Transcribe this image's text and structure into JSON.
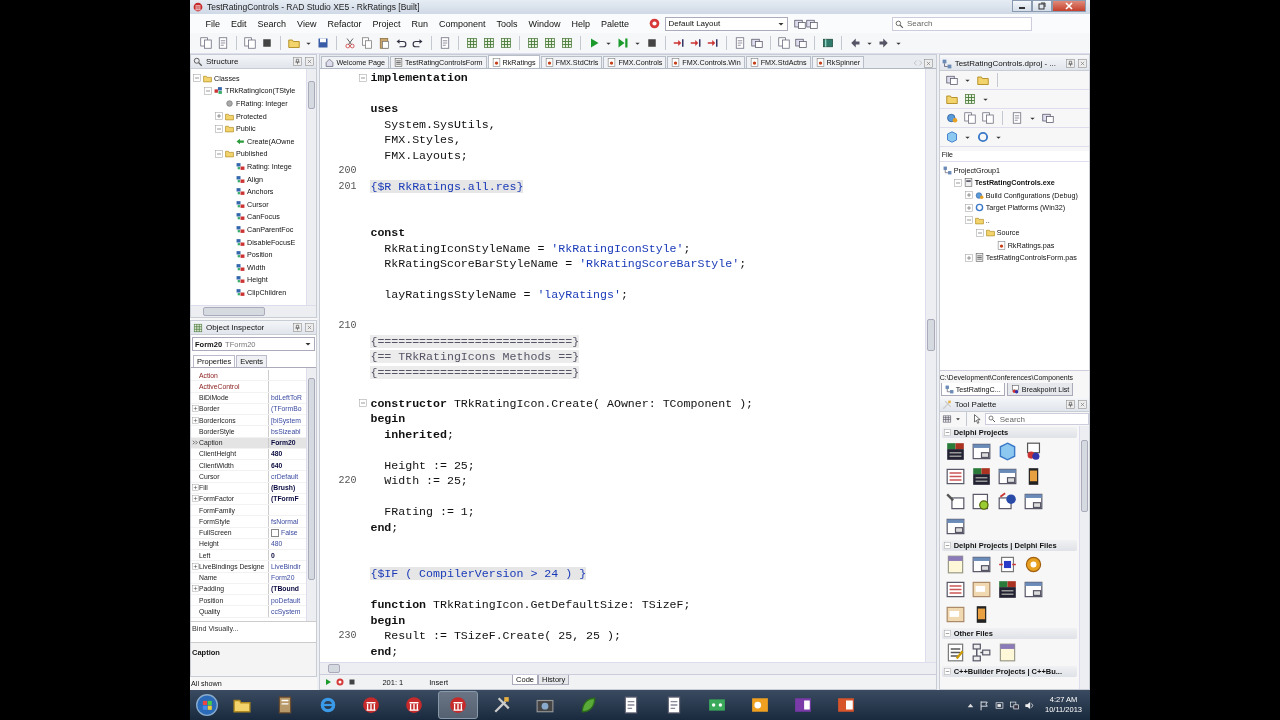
{
  "window": {
    "title": "TestRatingControls - RAD Studio XE5 - RkRatings [Built]"
  },
  "menu": [
    "File",
    "Edit",
    "Search",
    "View",
    "Refactor",
    "Project",
    "Run",
    "Component",
    "Tools",
    "Window",
    "Help",
    "Palette"
  ],
  "layout_dropdown": {
    "value": "Default Layout"
  },
  "ide_search": {
    "placeholder": "Search"
  },
  "structure": {
    "title": "Structure",
    "tree": [
      {
        "label": "Classes",
        "kind": "folder",
        "expanded": true,
        "children": [
          {
            "label": "TRkRatingIcon(TStyle",
            "kind": "class",
            "expanded": true,
            "children": [
              {
                "label": "FRating: Integer",
                "kind": "field"
              },
              {
                "label": "Protected",
                "kind": "folder",
                "expanded": false
              },
              {
                "label": "Public",
                "kind": "folder",
                "expanded": true,
                "children": [
                  {
                    "label": "Create(AOwne",
                    "kind": "method"
                  }
                ]
              },
              {
                "label": "Published",
                "kind": "folder",
                "expanded": true,
                "children": [
                  {
                    "label": "Rating: Intege",
                    "kind": "property"
                  },
                  {
                    "label": "Align",
                    "kind": "property"
                  },
                  {
                    "label": "Anchors",
                    "kind": "property"
                  },
                  {
                    "label": "Cursor",
                    "kind": "property"
                  },
                  {
                    "label": "CanFocus",
                    "kind": "property"
                  },
                  {
                    "label": "CanParentFoc",
                    "kind": "property"
                  },
                  {
                    "label": "DisableFocusE",
                    "kind": "property"
                  },
                  {
                    "label": "Position",
                    "kind": "property"
                  },
                  {
                    "label": "Width",
                    "kind": "property"
                  },
                  {
                    "label": "Height",
                    "kind": "property"
                  },
                  {
                    "label": "ClipChildren",
                    "kind": "property"
                  }
                ]
              }
            ]
          }
        ]
      }
    ]
  },
  "object_inspector": {
    "title": "Object Inspector",
    "component": "Form20",
    "component_type": "TForm20",
    "tabs": [
      {
        "label": "Properties",
        "selected": true
      },
      {
        "label": "Events",
        "selected": false
      }
    ],
    "properties": [
      {
        "name": "Action",
        "kind": "reference",
        "expandable": false,
        "selected": false
      },
      {
        "name": "ActiveControl",
        "kind": "reference",
        "expandable": false,
        "selected": false
      },
      {
        "name": "BiDiMode",
        "value": "bdLeftToR",
        "kind": "property",
        "expandable": false,
        "emphasis": false,
        "selected": false
      },
      {
        "name": "Border",
        "value": "(TFormBo",
        "kind": "property",
        "expandable": true,
        "emphasis": false,
        "selected": false
      },
      {
        "name": "BorderIcons",
        "value": "[biSystem",
        "kind": "property",
        "expandable": true,
        "emphasis": false,
        "selected": false
      },
      {
        "name": "BorderStyle",
        "value": "bsSizeabl",
        "kind": "property",
        "expandable": false,
        "emphasis": false,
        "selected": false
      },
      {
        "name": "Caption",
        "value": "Form20",
        "kind": "property",
        "expandable": false,
        "emphasis": true,
        "selected": true
      },
      {
        "name": "ClientHeight",
        "value": "480",
        "kind": "property",
        "expandable": false,
        "emphasis": true,
        "selected": false
      },
      {
        "name": "ClientWidth",
        "value": "640",
        "kind": "property",
        "expandable": false,
        "emphasis": true,
        "selected": false
      },
      {
        "name": "Cursor",
        "value": "crDefault",
        "kind": "property",
        "expandable": false,
        "emphasis": false,
        "selected": false
      },
      {
        "name": "Fill",
        "value": "(Brush)",
        "kind": "property",
        "expandable": true,
        "emphasis": true,
        "selected": false
      },
      {
        "name": "FormFactor",
        "value": "(TFormF",
        "kind": "property",
        "expandable": true,
        "emphasis": true,
        "selected": false
      },
      {
        "name": "FormFamily",
        "kind": "property",
        "expandable": false,
        "selected": false
      },
      {
        "name": "FormStyle",
        "value": "fsNormal",
        "kind": "property",
        "expandable": false,
        "emphasis": false,
        "selected": false
      },
      {
        "name": "FullScreen",
        "value": "False",
        "kind": "checkbox",
        "checked": false,
        "expandable": false,
        "emphasis": false,
        "selected": false
      },
      {
        "name": "Height",
        "value": "480",
        "kind": "property",
        "expandable": false,
        "emphasis": false,
        "selected": false
      },
      {
        "name": "Left",
        "value": "0",
        "kind": "property",
        "expandable": false,
        "emphasis": true,
        "selected": false
      },
      {
        "name": "LiveBindings Designe",
        "value": "LiveBindir",
        "kind": "property",
        "expandable": true,
        "emphasis": false,
        "selected": false
      },
      {
        "name": "Name",
        "value": "Form20",
        "kind": "property",
        "expandable": false,
        "emphasis": false,
        "selected": false
      },
      {
        "name": "Padding",
        "value": "(TBound",
        "kind": "property",
        "expandable": true,
        "emphasis": true,
        "selected": false
      },
      {
        "name": "Position",
        "value": "poDefault",
        "kind": "property",
        "expandable": false,
        "emphasis": false,
        "selected": false
      },
      {
        "name": "Quality",
        "value": "ccSystem",
        "kind": "property",
        "expandable": false,
        "emphasis": false,
        "selected": false
      }
    ],
    "action_link": "Bind Visually...",
    "description": "Caption",
    "footer": "All shown"
  },
  "editor": {
    "tabs": [
      {
        "label": "Welcome Page",
        "kind": "home",
        "selected": false
      },
      {
        "label": "TestRatingControlsForm",
        "kind": "formfile",
        "selected": false
      },
      {
        "label": "RkRatings",
        "kind": "pas",
        "selected": true
      },
      {
        "label": "FMX.StdCtrls",
        "kind": "pas",
        "selected": false
      },
      {
        "label": "FMX.Controls",
        "kind": "pas",
        "selected": false
      },
      {
        "label": "FMX.Controls.Win",
        "kind": "pas",
        "selected": false
      },
      {
        "label": "FMX.StdActns",
        "kind": "pas",
        "selected": false
      },
      {
        "label": "RkSpinner",
        "kind": "pas",
        "selected": false
      }
    ],
    "lines": [
      {
        "kind": "code",
        "foldable": true,
        "tokens": [
          {
            "kind": "keyword",
            "text": "implementation"
          }
        ]
      },
      {
        "kind": "blank"
      },
      {
        "kind": "code",
        "foldable": false,
        "tokens": [
          {
            "kind": "keyword",
            "text": "uses"
          }
        ]
      },
      {
        "kind": "code",
        "foldable": false,
        "tokens": [
          {
            "kind": "plain",
            "text": "  System.SysUtils,"
          }
        ]
      },
      {
        "kind": "code",
        "foldable": false,
        "tokens": [
          {
            "kind": "plain",
            "text": "  FMX.Styles,"
          }
        ]
      },
      {
        "kind": "code",
        "foldable": false,
        "tokens": [
          {
            "kind": "plain",
            "text": "  FMX.Layouts;"
          }
        ]
      },
      {
        "kind": "blank",
        "number": "200"
      },
      {
        "kind": "code",
        "number": "201",
        "foldable": false,
        "tokens": [
          {
            "kind": "directive",
            "text": "{$R RkRatings.all.res}"
          }
        ]
      },
      {
        "kind": "blank"
      },
      {
        "kind": "blank"
      },
      {
        "kind": "code",
        "foldable": false,
        "tokens": [
          {
            "kind": "keyword",
            "text": "const"
          }
        ]
      },
      {
        "kind": "code",
        "foldable": false,
        "tokens": [
          {
            "kind": "plain",
            "text": "  RkRatingIconStyleName = "
          },
          {
            "kind": "string",
            "text": "'RkRatingIconStyle'"
          },
          {
            "kind": "plain",
            "text": ";"
          }
        ]
      },
      {
        "kind": "code",
        "foldable": false,
        "tokens": [
          {
            "kind": "plain",
            "text": "  RkRatingScoreBarStyleName = "
          },
          {
            "kind": "string",
            "text": "'RkRatingScoreBarStyle'"
          },
          {
            "kind": "plain",
            "text": ";"
          }
        ]
      },
      {
        "kind": "blank"
      },
      {
        "kind": "code",
        "foldable": false,
        "tokens": [
          {
            "kind": "plain",
            "text": "  layRatingsStyleName = "
          },
          {
            "kind": "string",
            "text": "'layRatings'"
          },
          {
            "kind": "plain",
            "text": ";"
          }
        ]
      },
      {
        "kind": "blank"
      },
      {
        "kind": "blank",
        "number": "210"
      },
      {
        "kind": "code",
        "foldable": false,
        "tokens": [
          {
            "kind": "comment",
            "text": "{============================}"
          }
        ]
      },
      {
        "kind": "code",
        "foldable": false,
        "tokens": [
          {
            "kind": "comment",
            "text": "{== TRkRatingIcons Methods ==}"
          }
        ]
      },
      {
        "kind": "code",
        "foldable": false,
        "tokens": [
          {
            "kind": "comment",
            "text": "{============================}"
          }
        ]
      },
      {
        "kind": "blank"
      },
      {
        "kind": "code",
        "foldable": true,
        "tokens": [
          {
            "kind": "keyword",
            "text": "constructor"
          },
          {
            "kind": "plain",
            "text": " TRkRatingIcon.Create( AOwner: TComponent );"
          }
        ]
      },
      {
        "kind": "code",
        "foldable": false,
        "tokens": [
          {
            "kind": "keyword",
            "text": "begin"
          }
        ]
      },
      {
        "kind": "code",
        "foldable": false,
        "tokens": [
          {
            "kind": "keyword",
            "text": "  inherited"
          },
          {
            "kind": "plain",
            "text": ";"
          }
        ]
      },
      {
        "kind": "blank"
      },
      {
        "kind": "code",
        "foldable": false,
        "tokens": [
          {
            "kind": "plain",
            "text": "  Height := 25;"
          }
        ]
      },
      {
        "kind": "code",
        "number": "220",
        "foldable": false,
        "tokens": [
          {
            "kind": "plain",
            "text": "  Width := 25;"
          }
        ]
      },
      {
        "kind": "blank"
      },
      {
        "kind": "code",
        "foldable": false,
        "tokens": [
          {
            "kind": "plain",
            "text": "  FRating := 1;"
          }
        ]
      },
      {
        "kind": "code",
        "foldable": false,
        "tokens": [
          {
            "kind": "keyword",
            "text": "end"
          },
          {
            "kind": "plain",
            "text": ";"
          }
        ]
      },
      {
        "kind": "blank"
      },
      {
        "kind": "blank"
      },
      {
        "kind": "code",
        "foldable": false,
        "tokens": [
          {
            "kind": "directive",
            "text": "{$IF ( CompilerVersion > 24 ) }"
          }
        ]
      },
      {
        "kind": "blank"
      },
      {
        "kind": "code",
        "foldable": false,
        "tokens": [
          {
            "kind": "keyword",
            "text": "function"
          },
          {
            "kind": "plain",
            "text": " TRkRatingIcon.GetDefaultSize: TSizeF;"
          }
        ]
      },
      {
        "kind": "code",
        "foldable": false,
        "tokens": [
          {
            "kind": "keyword",
            "text": "begin"
          }
        ]
      },
      {
        "kind": "code",
        "number": "230",
        "foldable": false,
        "tokens": [
          {
            "kind": "plain",
            "text": "  Result := TSizeF.Create( 25, 25 );"
          }
        ]
      },
      {
        "kind": "code",
        "foldable": false,
        "tokens": [
          {
            "kind": "keyword",
            "text": "end"
          },
          {
            "kind": "plain",
            "text": ";"
          }
        ]
      }
    ],
    "status": {
      "position": "201: 1",
      "mode": "Insert"
    },
    "view_tabs": [
      {
        "label": "Code",
        "selected": true
      },
      {
        "label": "History",
        "selected": false
      }
    ]
  },
  "project_manager": {
    "title": "TestRatingControls.dproj - ...",
    "column": "File",
    "tree": [
      {
        "label": "ProjectGroup1",
        "kind": "group",
        "children": [
          {
            "label": "TestRatingControls.exe",
            "kind": "project",
            "expanded": true,
            "children": [
              {
                "label": "Build Configurations (Debug)",
                "kind": "config",
                "expanded": false
              },
              {
                "label": "Target Platforms (Win32)",
                "kind": "platform",
                "expanded": false
              },
              {
                "label": "..",
                "kind": "folder",
                "expanded": true,
                "children": [
                  {
                    "label": "Source",
                    "kind": "folder",
                    "expanded": true,
                    "children": [
                      {
                        "label": "RkRatings.pas",
                        "kind": "pas"
                      }
                    ]
                  }
                ]
              },
              {
                "label": "TestRatingControlsForm.pas",
                "kind": "formfile",
                "expanded": false
              }
            ]
          }
        ]
      }
    ],
    "path": "C:\\Development\\Conferences\\Components",
    "tabs": [
      {
        "label": "TestRatingC...",
        "selected": true
      },
      {
        "label": "Breakpoint List",
        "selected": false
      }
    ]
  },
  "tool_palette": {
    "title": "Tool Palette",
    "search": {
      "placeholder": "Search"
    },
    "categories": [
      {
        "label": "Delphi Projects",
        "expanded": true,
        "tiles": [
          {
            "kind": "form"
          },
          {
            "kind": "window"
          },
          {
            "kind": "cube"
          },
          {
            "kind": "dll"
          },
          {
            "kind": "list"
          },
          {
            "kind": "form"
          },
          {
            "kind": "window"
          },
          {
            "kind": "phone"
          },
          {
            "kind": "wizard"
          },
          {
            "kind": "gearwin"
          },
          {
            "kind": "globe"
          },
          {
            "kind": "window"
          },
          {
            "kind": "window"
          }
        ]
      },
      {
        "label": "Delphi Projects | Delphi Files",
        "expanded": true,
        "tiles": [
          {
            "kind": "xml"
          },
          {
            "kind": "window"
          },
          {
            "kind": "chip"
          },
          {
            "kind": "gear"
          },
          {
            "kind": "list"
          },
          {
            "kind": "photo"
          },
          {
            "kind": "form"
          },
          {
            "kind": "window"
          },
          {
            "kind": "photo"
          },
          {
            "kind": "phone"
          }
        ]
      },
      {
        "label": "Other Files",
        "expanded": true,
        "tiles": [
          {
            "kind": "note"
          },
          {
            "kind": "flow"
          },
          {
            "kind": "xml"
          }
        ]
      },
      {
        "label": "C++Builder Projects | C++Bu...",
        "expanded": true
      }
    ]
  },
  "taskbar": {
    "apps": [
      {
        "kind": "explorer",
        "selected": false
      },
      {
        "kind": "notebook",
        "selected": false
      },
      {
        "kind": "ie",
        "selected": false
      },
      {
        "kind": "rad",
        "selected": false
      },
      {
        "kind": "rad",
        "selected": false
      },
      {
        "kind": "rad",
        "selected": true
      },
      {
        "kind": "tools",
        "selected": false
      },
      {
        "kind": "camera",
        "selected": false
      },
      {
        "kind": "leaf",
        "selected": false
      },
      {
        "kind": "doc",
        "selected": false
      },
      {
        "kind": "doc",
        "selected": false
      },
      {
        "kind": "game",
        "selected": false
      },
      {
        "kind": "outlook",
        "selected": false
      },
      {
        "kind": "onenote",
        "selected": false
      },
      {
        "kind": "ppt",
        "selected": false
      }
    ],
    "clock": {
      "time": "4:27 AM",
      "date": "10/11/2013"
    }
  }
}
